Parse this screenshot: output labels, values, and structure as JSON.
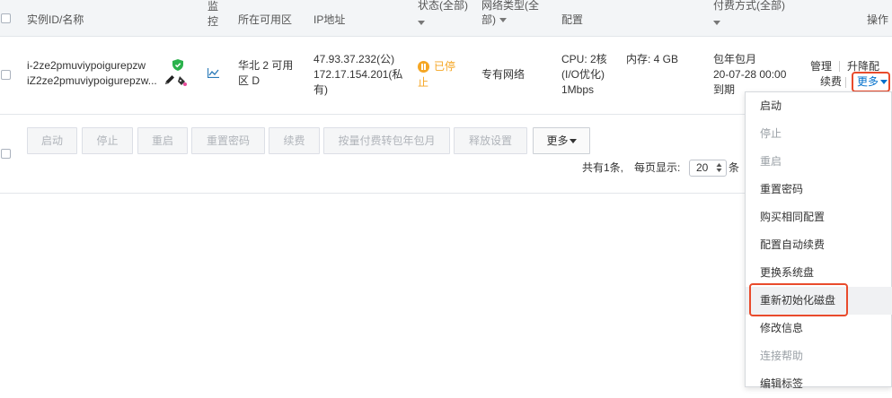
{
  "header": {
    "instance_col": "实例ID/名称",
    "monitor_col_1": "监",
    "monitor_col_2": "控",
    "zone_col": "所在可用区",
    "ip_col": "IP地址",
    "status_col_1": "状态(全部)",
    "network_col_1": "网络类型(全",
    "network_col_2": "部)",
    "config_col": "配置",
    "billing_col": "付费方式(全部)",
    "action_col": "操作"
  },
  "instance": {
    "id": "i-2ze2pmuviypoigurepzw",
    "name": "iZ2ze2pmuviypoigurepzw...",
    "zone_line1": "华北 2 可用",
    "zone_line2": "区 D",
    "ip_public": "47.93.37.232(公)",
    "ip_private_line1": "172.17.154.201(私",
    "ip_private_line2": "有)",
    "status_line1": "已停",
    "status_line2": "止",
    "network": "专有网络",
    "cpu": "CPU:  2核",
    "memory": "内存: 4 GB",
    "io_opt": "(I/O优化)",
    "bandwidth": "1Mbps",
    "billing_line1": "包年包月",
    "billing_line2": "20-07-28 00:00",
    "billing_line3": "到期",
    "action_manage": "管理",
    "action_upgrade": "升降配",
    "action_renew": "续费",
    "action_more": "更多"
  },
  "batch": {
    "start": "启动",
    "stop": "停止",
    "restart": "重启",
    "reset_password": "重置密码",
    "renew": "续费",
    "convert": "按量付费转包年包月",
    "release": "释放设置",
    "more": "更多"
  },
  "pagination": {
    "total": "共有1条,",
    "per_page_label": "每页显示:",
    "per_page_value": "20",
    "suffix": "条"
  },
  "more_menu": [
    {
      "label": "启动",
      "disabled": false
    },
    {
      "label": "停止",
      "disabled": true
    },
    {
      "label": "重启",
      "disabled": true
    },
    {
      "label": "重置密码",
      "disabled": false
    },
    {
      "label": "购买相同配置",
      "disabled": false
    },
    {
      "label": "配置自动续费",
      "disabled": false
    },
    {
      "label": "更换系统盘",
      "disabled": false
    },
    {
      "label": "重新初始化磁盘",
      "disabled": false
    },
    {
      "label": "修改信息",
      "disabled": false
    },
    {
      "label": "连接帮助",
      "disabled": true
    },
    {
      "label": "编辑标签",
      "disabled": false
    }
  ],
  "colors": {
    "link": "#0070cc",
    "status_stopped": "#f5a623",
    "highlight_box": "#e94b2c"
  }
}
